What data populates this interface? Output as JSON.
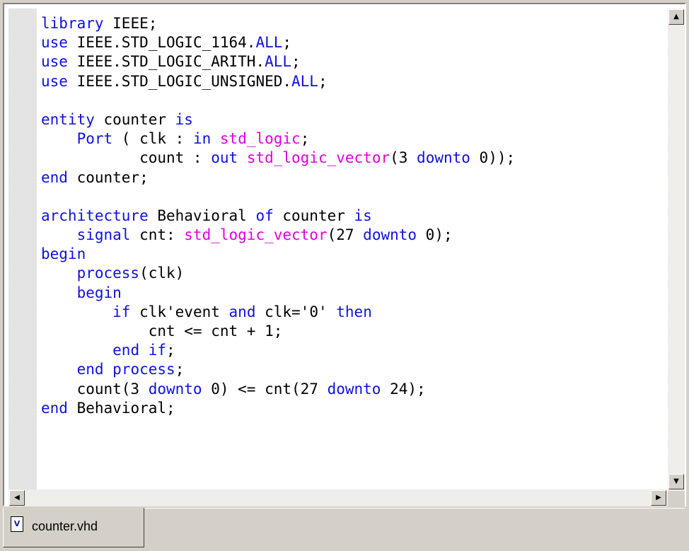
{
  "editor": {
    "lines": [
      [
        {
          "t": "library",
          "c": "kw"
        },
        {
          "t": " IEEE;",
          "c": ""
        }
      ],
      [
        {
          "t": "use",
          "c": "kw"
        },
        {
          "t": " IEEE.STD_LOGIC_1164.",
          "c": ""
        },
        {
          "t": "ALL",
          "c": "kw"
        },
        {
          "t": ";",
          "c": ""
        }
      ],
      [
        {
          "t": "use",
          "c": "kw"
        },
        {
          "t": " IEEE.STD_LOGIC_ARITH.",
          "c": ""
        },
        {
          "t": "ALL",
          "c": "kw"
        },
        {
          "t": ";",
          "c": ""
        }
      ],
      [
        {
          "t": "use",
          "c": "kw"
        },
        {
          "t": " IEEE.STD_LOGIC_UNSIGNED.",
          "c": ""
        },
        {
          "t": "ALL",
          "c": "kw"
        },
        {
          "t": ";",
          "c": ""
        }
      ],
      [],
      [
        {
          "t": "entity",
          "c": "kw"
        },
        {
          "t": " counter ",
          "c": ""
        },
        {
          "t": "is",
          "c": "kw"
        }
      ],
      [
        {
          "t": "    ",
          "c": ""
        },
        {
          "t": "Port",
          "c": "kw"
        },
        {
          "t": " ( clk : ",
          "c": ""
        },
        {
          "t": "in",
          "c": "kw"
        },
        {
          "t": " ",
          "c": ""
        },
        {
          "t": "std_logic",
          "c": "ty"
        },
        {
          "t": ";",
          "c": ""
        }
      ],
      [
        {
          "t": "           count : ",
          "c": ""
        },
        {
          "t": "out",
          "c": "kw"
        },
        {
          "t": " ",
          "c": ""
        },
        {
          "t": "std_logic_vector",
          "c": "ty"
        },
        {
          "t": "(3 ",
          "c": ""
        },
        {
          "t": "downto",
          "c": "kw"
        },
        {
          "t": " 0));",
          "c": ""
        }
      ],
      [
        {
          "t": "end",
          "c": "kw"
        },
        {
          "t": " counter;",
          "c": ""
        }
      ],
      [],
      [
        {
          "t": "architecture",
          "c": "kw"
        },
        {
          "t": " Behavioral ",
          "c": ""
        },
        {
          "t": "of",
          "c": "kw"
        },
        {
          "t": " counter ",
          "c": ""
        },
        {
          "t": "is",
          "c": "kw"
        }
      ],
      [
        {
          "t": "    ",
          "c": ""
        },
        {
          "t": "signal",
          "c": "kw"
        },
        {
          "t": " cnt: ",
          "c": ""
        },
        {
          "t": "std_logic_vector",
          "c": "ty"
        },
        {
          "t": "(27 ",
          "c": ""
        },
        {
          "t": "downto",
          "c": "kw"
        },
        {
          "t": " 0);",
          "c": ""
        }
      ],
      [
        {
          "t": "begin",
          "c": "kw"
        }
      ],
      [
        {
          "t": "    ",
          "c": ""
        },
        {
          "t": "process",
          "c": "kw"
        },
        {
          "t": "(clk)",
          "c": ""
        }
      ],
      [
        {
          "t": "    ",
          "c": ""
        },
        {
          "t": "begin",
          "c": "kw"
        }
      ],
      [
        {
          "t": "        ",
          "c": ""
        },
        {
          "t": "if",
          "c": "kw"
        },
        {
          "t": " clk'event ",
          "c": ""
        },
        {
          "t": "and",
          "c": "kw"
        },
        {
          "t": " clk='0' ",
          "c": ""
        },
        {
          "t": "then",
          "c": "kw"
        }
      ],
      [
        {
          "t": "            cnt <= cnt + 1;",
          "c": ""
        }
      ],
      [
        {
          "t": "        ",
          "c": ""
        },
        {
          "t": "end",
          "c": "kw"
        },
        {
          "t": " ",
          "c": ""
        },
        {
          "t": "if",
          "c": "kw"
        },
        {
          "t": ";",
          "c": ""
        }
      ],
      [
        {
          "t": "    ",
          "c": ""
        },
        {
          "t": "end",
          "c": "kw"
        },
        {
          "t": " ",
          "c": ""
        },
        {
          "t": "process",
          "c": "kw"
        },
        {
          "t": ";",
          "c": ""
        }
      ],
      [
        {
          "t": "    count(3 ",
          "c": ""
        },
        {
          "t": "downto",
          "c": "kw"
        },
        {
          "t": " 0) <= cnt(27 ",
          "c": ""
        },
        {
          "t": "downto",
          "c": "kw"
        },
        {
          "t": " 24);",
          "c": ""
        }
      ],
      [
        {
          "t": "end",
          "c": "kw"
        },
        {
          "t": " Behavioral;",
          "c": ""
        }
      ]
    ]
  },
  "tab": {
    "label": "counter.vhd",
    "icon": "vhdl-file-icon"
  },
  "scroll": {
    "up": "▲",
    "down": "▼",
    "left": "◀",
    "right": "▶"
  },
  "colors": {
    "keyword": "#1010e0",
    "type": "#e000e0",
    "text": "#000000"
  }
}
